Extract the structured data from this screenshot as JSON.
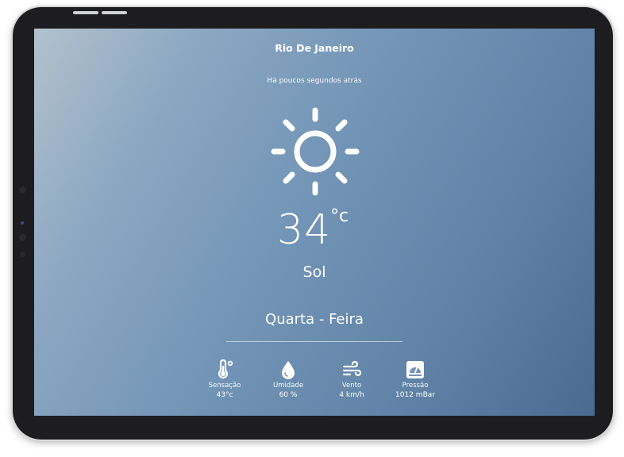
{
  "header": {
    "city": "Rio De Janeiro",
    "updated": "Há poucos segundos atrás"
  },
  "current": {
    "icon": "sun-icon",
    "temperature": "34",
    "unit": "°c",
    "condition": "Sol",
    "weekday": "Quarta - Feira"
  },
  "stats": [
    {
      "icon": "thermometer-icon",
      "label": "Sensação",
      "value": "43°c"
    },
    {
      "icon": "water-drop-icon",
      "label": "Umidade",
      "value": "60 %"
    },
    {
      "icon": "wind-icon",
      "label": "Vento",
      "value": "4 km/h"
    },
    {
      "icon": "barometer-icon",
      "label": "Pressão",
      "value": "1012 mBar"
    }
  ],
  "colors": {
    "gradient_start": "#b3c1cd",
    "gradient_end": "#4a6b91",
    "text": "#ffffff",
    "device_frame": "#1d1d1f"
  }
}
